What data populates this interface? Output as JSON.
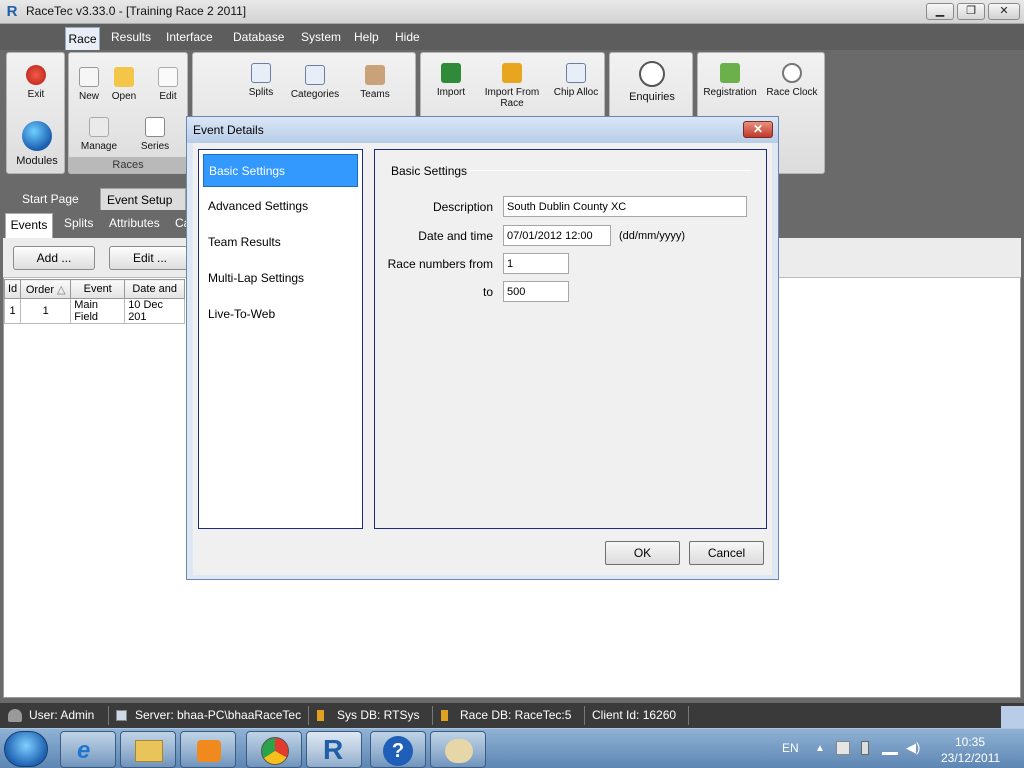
{
  "window": {
    "title": "RaceTec v3.33.0 - [Training Race 2  2011]",
    "logo": "R"
  },
  "menu": [
    "Race",
    "Results",
    "Interface",
    "Database",
    "System",
    "Help",
    "Hide"
  ],
  "ribbon": {
    "exit": "Exit",
    "modules": "Modules",
    "new": "New",
    "open": "Open",
    "edit": "Edit",
    "manage": "Manage",
    "series": "Series",
    "races_group": "Races",
    "splits": "Splits",
    "categories": "Categories",
    "teams": "Teams",
    "import": "Import",
    "import_from_race": "Import From Race",
    "chip_alloc": "Chip Alloc",
    "enquiries": "Enquiries",
    "registration": "Registration",
    "race_clock": "Race Clock"
  },
  "doc_tabs": [
    "Start Page",
    "Event Setup"
  ],
  "sub_tabs": [
    "Events",
    "Splits",
    "Attributes",
    "Ca"
  ],
  "toolbar": {
    "add": "Add ...",
    "edit": "Edit ..."
  },
  "events_table": {
    "columns": [
      "Id",
      "Order",
      "Event",
      "Date and"
    ],
    "sort_indicator": "△",
    "rows": [
      [
        "1",
        "1",
        "Main Field",
        "10 Dec 201"
      ]
    ]
  },
  "dialog": {
    "title": "Event Details",
    "close": "✕",
    "nav": [
      "Basic Settings",
      "Advanced Settings",
      "Team Results",
      "Multi-Lap Settings",
      "Live-To-Web"
    ],
    "selected_nav": "Basic Settings",
    "panel_heading": "Basic Settings",
    "labels": {
      "description": "Description",
      "date_time": "Date and time",
      "race_from": "Race numbers from",
      "race_to": "to"
    },
    "values": {
      "description": "South Dublin County XC",
      "date_time": "07/01/2012 12:00",
      "race_from": "1",
      "race_to": "500"
    },
    "date_format_hint": "(dd/mm/yyyy)",
    "ok": "OK",
    "cancel": "Cancel"
  },
  "status": {
    "user": "User: Admin",
    "server": "Server: bhaa-PC\\bhaaRaceTec",
    "sysdb": "Sys DB: RTSys",
    "racedb": "Race DB: RaceTec:5",
    "client": "Client Id: 16260"
  },
  "taskbar": {
    "lang": "EN",
    "time": "10:35",
    "date": "23/12/2011"
  },
  "colors": {
    "selection": "#3399ff",
    "dialog_border": "#1f2a7a",
    "close_red": "#c0392b"
  }
}
